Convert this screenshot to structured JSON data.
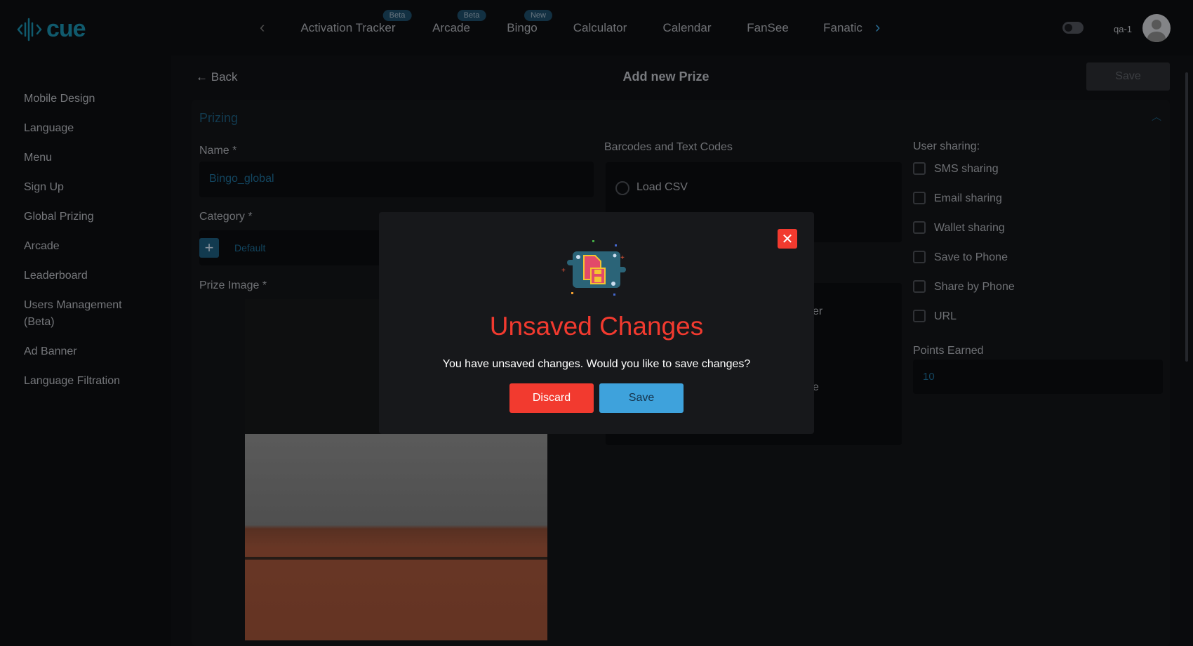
{
  "header": {
    "logo": "cue",
    "nav": [
      {
        "label": "Activation Tracker",
        "badge": "Beta"
      },
      {
        "label": "Arcade",
        "badge": "Beta"
      },
      {
        "label": "Bingo",
        "badge": "New"
      },
      {
        "label": "Calculator"
      },
      {
        "label": "Calendar"
      },
      {
        "label": "FanSee"
      },
      {
        "label": "Fanatic"
      }
    ],
    "user": "qa-1"
  },
  "sidebar": {
    "items": [
      "Mobile Design",
      "Language",
      "Menu",
      "Sign Up",
      "Global Prizing",
      "Arcade",
      "Leaderboard",
      "Users Management",
      "(Beta)",
      "Ad Banner",
      "Language Filtration"
    ]
  },
  "page": {
    "back": "Back",
    "title": "Add new Prize",
    "save": "Save"
  },
  "prizing": {
    "section": "Prizing",
    "name_label": "Name *",
    "name_value": "Bingo_global",
    "category_label": "Category *",
    "category_value": "Default",
    "image_label": "Prize Image *",
    "barcodes_label": "Barcodes and Text Codes",
    "load_csv": "Load CSV",
    "partial_1": "ser",
    "partial_2": "ze",
    "sharing_label": "User sharing:",
    "sharing": [
      "SMS sharing",
      "Email sharing",
      "Wallet sharing",
      "Save to Phone",
      "Share by Phone",
      "URL"
    ],
    "points_label": "Points Earned",
    "points_value": "10"
  },
  "modal": {
    "title": "Unsaved Changes",
    "message": "You have unsaved changes. Would you like to save changes?",
    "discard": "Discard",
    "save": "Save"
  },
  "colors": {
    "accent": "#1a8aa8",
    "danger": "#f23a2f",
    "save": "#3ea2dc"
  }
}
